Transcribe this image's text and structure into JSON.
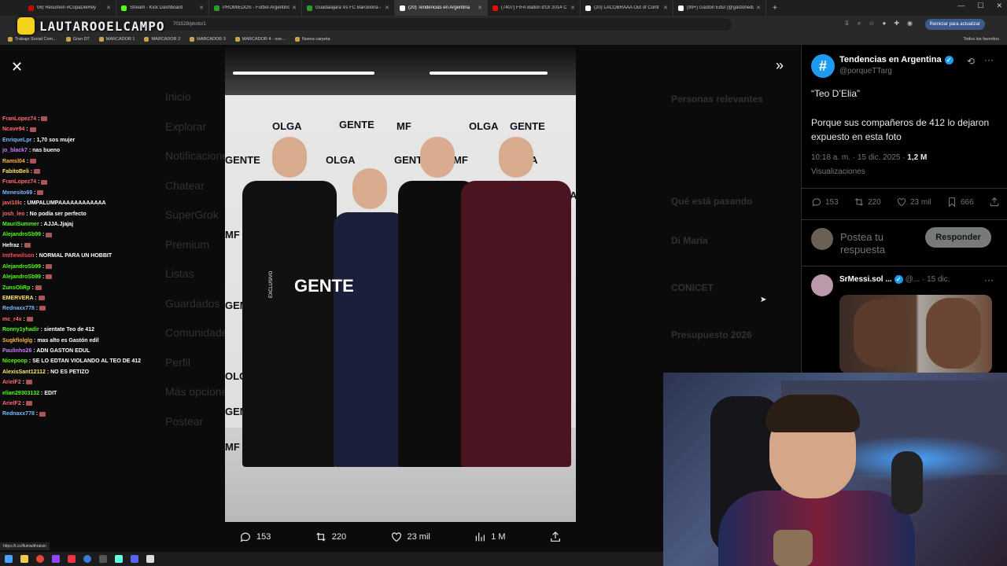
{
  "browser": {
    "tabs": [
      {
        "label": "06) Resumen #CopaDelRey",
        "color": "#c00"
      },
      {
        "label": "Stream - Kick Dashboard",
        "color": "#53fc18"
      },
      {
        "label": "PROMIEDOS - Futbol Argentino",
        "color": "#2a9d2a"
      },
      {
        "label": "Guadalajara Vs FC Barcelona -",
        "color": "#2a9d2a"
      },
      {
        "label": "(20) Tendencias en Argentina",
        "color": "#fff",
        "active": true
      },
      {
        "label": "(7407) FIFA Ballon d'Or 2014 C",
        "color": "#f00"
      },
      {
        "label": "(20) LACOBRAAA Out of Contr",
        "color": "#fff"
      },
      {
        "label": "(99+) Gastón Edul (@gastonedul)",
        "color": "#fff"
      }
    ],
    "url": "701529/photo/1",
    "update_button": "Reiniciar para actualizar",
    "bookmarks": [
      "Trabajo Social Com...",
      "Gran DT",
      "MARCADOR 1",
      "MARCADOR 2",
      "MARCADOR 3",
      "MARCADOR 4 - ove...",
      "Nueva carpeta"
    ],
    "all_bookmarks": "Todos los favoritos"
  },
  "overlay": {
    "streamer_name": "LAUTAROOELCAMPO"
  },
  "background_nav": [
    "Inicio",
    "Explorar",
    "Notificaciones",
    "Chatear",
    "SuperGrok",
    "Premium",
    "Listas",
    "Guardados",
    "Comunidades",
    "Perfil",
    "Más opciones",
    "Postear"
  ],
  "background_right": [
    "Personas relevantes",
    "Qué está pasando",
    "Di María",
    "CONICET",
    "Presupuesto 2026"
  ],
  "chat": [
    {
      "user": "FranLopez74",
      "color": "#ff6b6b",
      "msg": ""
    },
    {
      "user": "Ncave94",
      "color": "#ff6b6b",
      "msg": ""
    },
    {
      "user": "EnriqueLpr",
      "color": "#7ab8ff",
      "msg": "1,70 sos mujer"
    },
    {
      "user": "jo_black7",
      "color": "#c77dff",
      "msg": "nas bueno"
    },
    {
      "user": "Ramsl04",
      "color": "#ffb347",
      "msg": ""
    },
    {
      "user": "FabitoBeli",
      "color": "#ffe66d",
      "msg": ""
    },
    {
      "user": "FranLopez74",
      "color": "#ff6b6b",
      "msg": ""
    },
    {
      "user": "Menesito69",
      "color": "#7ab8ff",
      "msg": ""
    },
    {
      "user": "javi10lc",
      "color": "#ff6b6b",
      "msg": "UMPALUMPAAAAAAAAAAAA"
    },
    {
      "user": "josh_leo",
      "color": "#ff6b6b",
      "msg": "No podía ser perfecto"
    },
    {
      "user": "MauriSummer",
      "color": "#53fc18",
      "msg": "AJJA.Jjajaj"
    },
    {
      "user": "AlejandroSb99",
      "color": "#53fc18",
      "msg": ""
    },
    {
      "user": "Hefraz",
      "color": "#ffffff",
      "msg": ""
    },
    {
      "user": "Imthewilson",
      "color": "#ff4757",
      "msg": "NORMAL PARA UN HOBBIT"
    },
    {
      "user": "AlejandroSb99",
      "color": "#53fc18",
      "msg": ""
    },
    {
      "user": "AlejandroSb99",
      "color": "#53fc18",
      "msg": ""
    },
    {
      "user": "ZunsOliRp",
      "color": "#53fc18",
      "msg": ""
    },
    {
      "user": "EMERVERA",
      "color": "#ffe66d",
      "msg": ""
    },
    {
      "user": "Rednaxx778",
      "color": "#7ab8ff",
      "msg": ""
    },
    {
      "user": "mc_r4x",
      "color": "#ff6b6b",
      "msg": ""
    },
    {
      "user": "Ronny1yhadir",
      "color": "#53fc18",
      "msg": "sientate Teo de 412"
    },
    {
      "user": "Sugkfiolglg",
      "color": "#ffb347",
      "msg": "mas alto es Gastón edil"
    },
    {
      "user": "Paulinho26",
      "color": "#c77dff",
      "msg": "ADN GASTON EDUL"
    },
    {
      "user": "Nicepoop",
      "color": "#53fc18",
      "msg": "SE LO EDTAN VIOLANDO AL TEO DE 412"
    },
    {
      "user": "AlexisSant12112",
      "color": "#ffe66d",
      "msg": "NO ES PETIZO"
    },
    {
      "user": "ArielF2",
      "color": "#ff6b6b",
      "msg": ""
    },
    {
      "user": "elian29303132",
      "color": "#53fc18",
      "msg": "EDIT"
    },
    {
      "user": "ArielF2",
      "color": "#ff6b6b",
      "msg": ""
    },
    {
      "user": "Rednaxx778",
      "color": "#7ab8ff",
      "msg": ""
    }
  ],
  "photo": {
    "brands": [
      "OLGA",
      "GENTE",
      "MF"
    ],
    "exclusive": "EXCLUSIVO",
    "gente_big": "GENTE"
  },
  "photo_actions": {
    "replies": "153",
    "reposts": "220",
    "likes": "23 mil",
    "views": "1 M"
  },
  "post": {
    "author": "Tendencias en Argentina",
    "handle": "@porqueTTarg",
    "avatar_symbol": "#",
    "title": "“Teo D’Elia”",
    "body": "Porque sus compañeros de 412 lo dejaron expuesto en esta foto",
    "time": "10:18 a. m. · 15 dic. 2025 · ",
    "views_count": "1,2 M",
    "views_label": "Visualizaciones",
    "replies": "153",
    "reposts": "220",
    "likes": "23 mil",
    "bookmarks": "666",
    "reply_placeholder": "Postea tu respuesta",
    "reply_button": "Responder"
  },
  "reply": {
    "author": "SrMessi.sol ...",
    "meta": "@... · 15 dic."
  },
  "status_url": "https://t.co/flumwithraisin"
}
